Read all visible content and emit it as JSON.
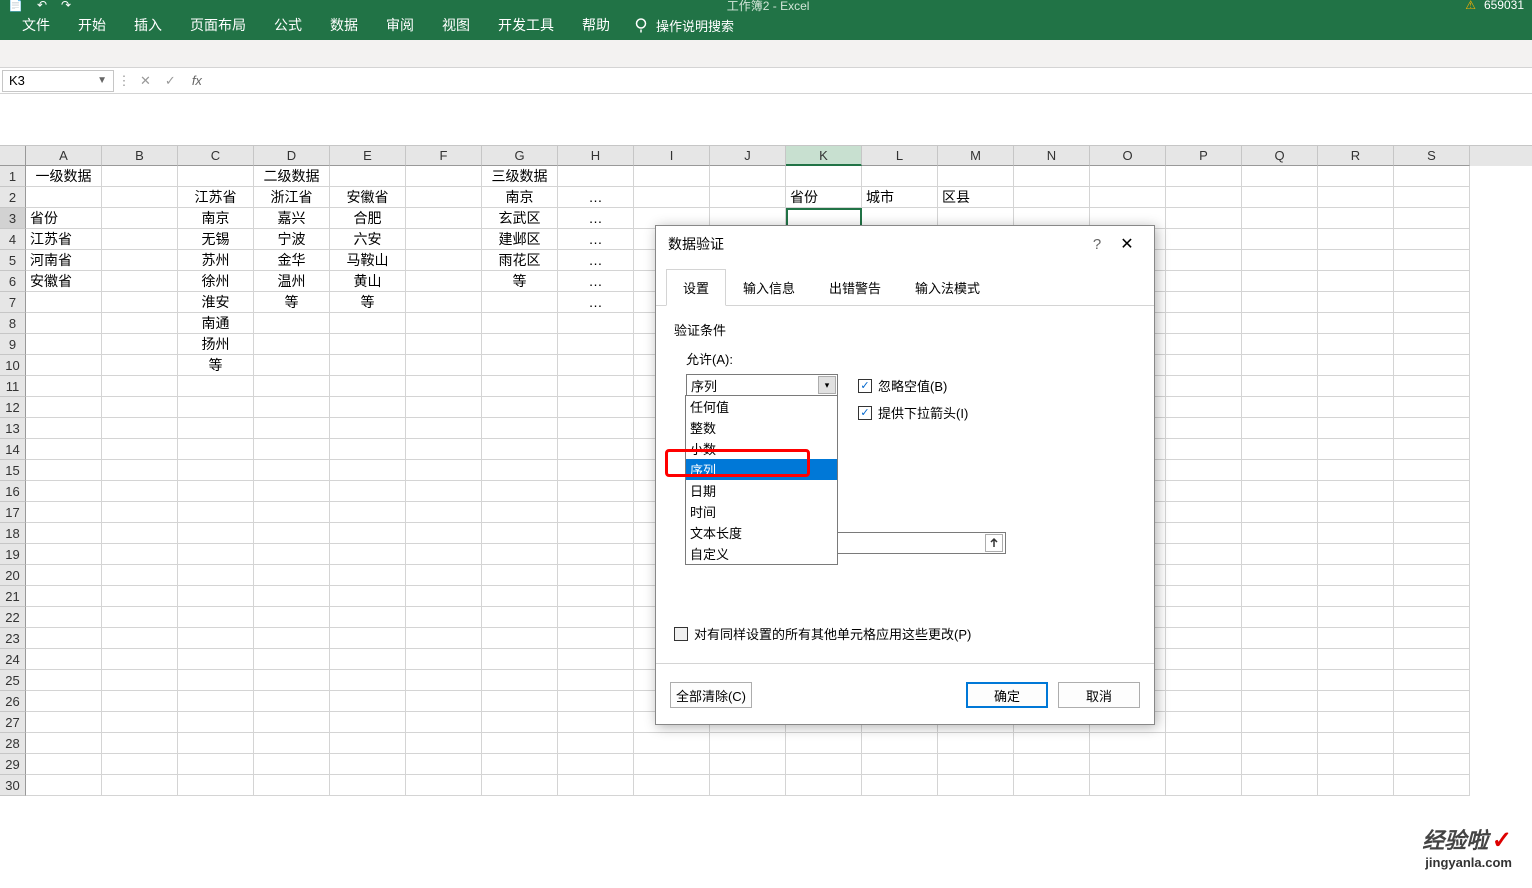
{
  "title_bar": {
    "doc_title": "工作簿2 - Excel",
    "user_id": "659031"
  },
  "ribbon": {
    "tabs": [
      "文件",
      "开始",
      "插入",
      "页面布局",
      "公式",
      "数据",
      "审阅",
      "视图",
      "开发工具",
      "帮助"
    ],
    "tell_me": "操作说明搜索"
  },
  "name_box": {
    "value": "K3"
  },
  "fx": {
    "cancel": "✕",
    "confirm": "✓",
    "label": "fx"
  },
  "columns": [
    "A",
    "B",
    "C",
    "D",
    "E",
    "F",
    "G",
    "H",
    "I",
    "J",
    "K",
    "L",
    "M",
    "N",
    "O",
    "P",
    "Q",
    "R",
    "S"
  ],
  "rows": [
    "1",
    "2",
    "3",
    "4",
    "5",
    "6",
    "7",
    "8",
    "9",
    "10",
    "11",
    "12",
    "13",
    "14",
    "15",
    "16",
    "17",
    "18",
    "19",
    "20",
    "21",
    "22",
    "23",
    "24",
    "25",
    "26",
    "27",
    "28",
    "29",
    "30"
  ],
  "sheet": {
    "r1": {
      "A": "一级数据",
      "D": "二级数据",
      "G": "三级数据"
    },
    "r2": {
      "C": "江苏省",
      "D": "浙江省",
      "E": "安徽省",
      "G": "南京",
      "H": "…",
      "K": "省份",
      "L": "城市",
      "M": "区县"
    },
    "r3": {
      "A": "省份",
      "C": "南京",
      "D": "嘉兴",
      "E": "合肥",
      "G": "玄武区",
      "H": "…"
    },
    "r4": {
      "A": "江苏省",
      "C": "无锡",
      "D": "宁波",
      "E": "六安",
      "G": "建邺区",
      "H": "…"
    },
    "r5": {
      "A": "河南省",
      "C": "苏州",
      "D": "金华",
      "E": "马鞍山",
      "G": "雨花区",
      "H": "…"
    },
    "r6": {
      "A": "安徽省",
      "C": "徐州",
      "D": "温州",
      "E": "黄山",
      "G": "等",
      "H": "…"
    },
    "r7": {
      "C": "淮安",
      "D": "等",
      "E": "等",
      "H": "…"
    },
    "r8": {
      "C": "南通"
    },
    "r9": {
      "C": "扬州"
    },
    "r10": {
      "C": "等"
    }
  },
  "dialog": {
    "title": "数据验证",
    "help": "?",
    "close": "✕",
    "tabs": [
      "设置",
      "输入信息",
      "出错警告",
      "输入法模式"
    ],
    "section": "验证条件",
    "allow_label": "允许(A):",
    "allow_value": "序列",
    "checks": {
      "ignore_blank": "忽略空值(B)",
      "dropdown": "提供下拉箭头(I)"
    },
    "apply_all": "对有同样设置的所有其他单元格应用这些更改(P)",
    "clear": "全部清除(C)",
    "ok": "确定",
    "cancel": "取消"
  },
  "dropdown": {
    "items": [
      "任何值",
      "整数",
      "小数",
      "序列",
      "日期",
      "时间",
      "文本长度",
      "自定义"
    ]
  },
  "watermark": {
    "main": "经验啦",
    "check": "✓",
    "sub": "jingyanla.com"
  }
}
